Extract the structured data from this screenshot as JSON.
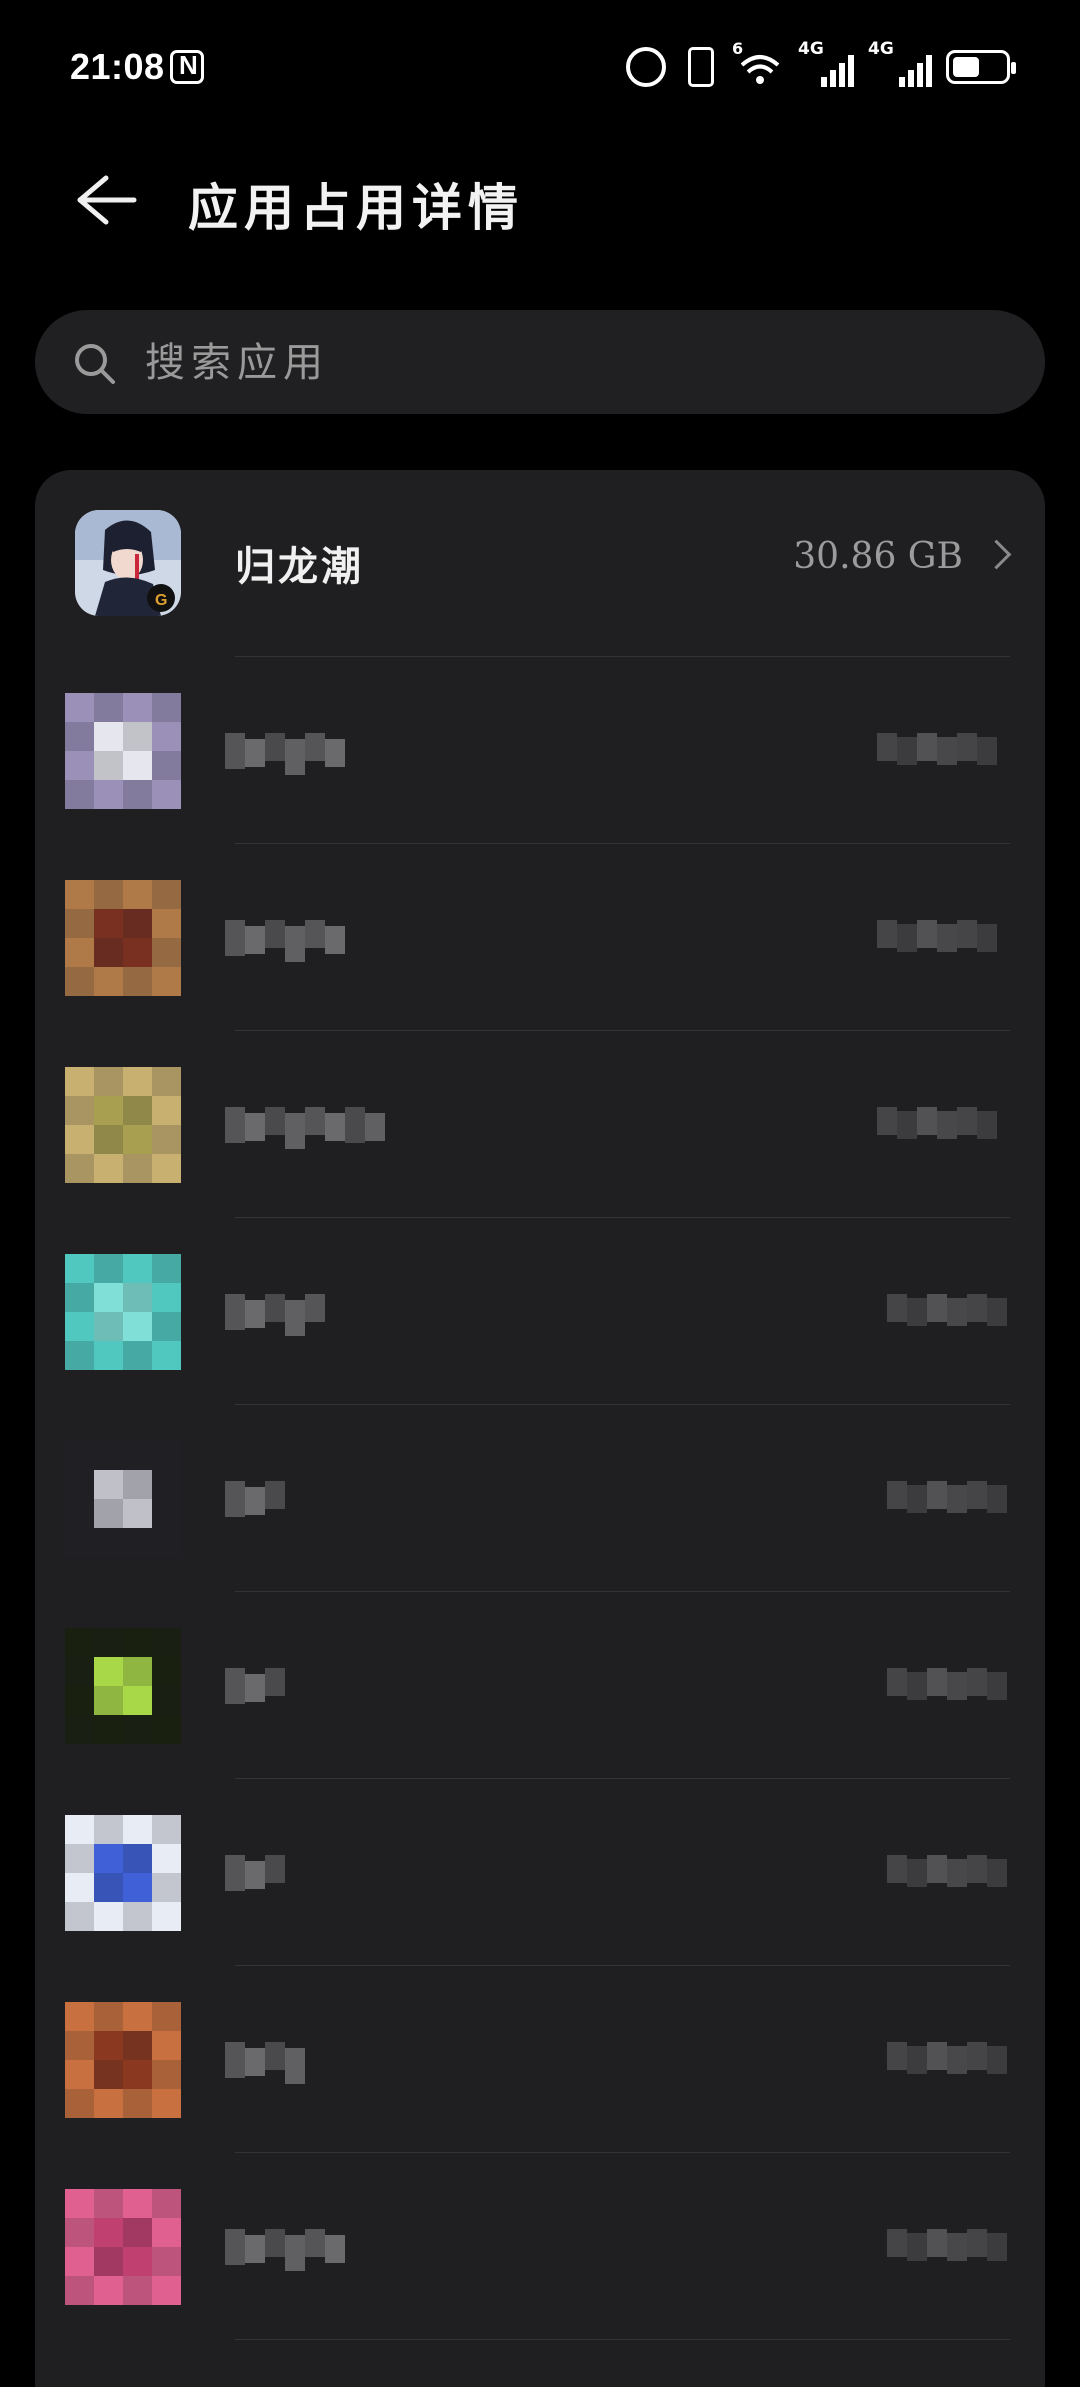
{
  "status_bar": {
    "time": "21:08",
    "wifi_label": "6",
    "sim1_label": "4G",
    "sim2_label": "4G"
  },
  "header": {
    "title": "应用占用详情"
  },
  "search": {
    "placeholder": "搜索应用"
  },
  "apps": [
    {
      "name": "归龙潮",
      "size": "30.86 GB",
      "icon": "app-icon-guilongchao",
      "pixelated": false
    }
  ],
  "pixelated_rows": [
    {
      "icon_color": "#9a90b8",
      "accent": "#e6e6ee"
    },
    {
      "icon_color": "#b07a48",
      "accent": "#7a3020"
    },
    {
      "icon_color": "#c8b070",
      "accent": "#a8a050"
    },
    {
      "icon_color": "#50c8c0",
      "accent": "#80e0d8"
    },
    {
      "icon_color": "#202024",
      "accent": "#c0c0c8"
    },
    {
      "icon_color": "#1a2010",
      "accent": "#a8d848"
    },
    {
      "icon_color": "#e8ecf4",
      "accent": "#4060d8"
    },
    {
      "icon_color": "#c87040",
      "accent": "#8a3820"
    },
    {
      "icon_color": "#e06090",
      "accent": "#c04070"
    }
  ],
  "colors": {
    "background": "#000000",
    "card": "#1f1f21",
    "search": "#202022"
  }
}
